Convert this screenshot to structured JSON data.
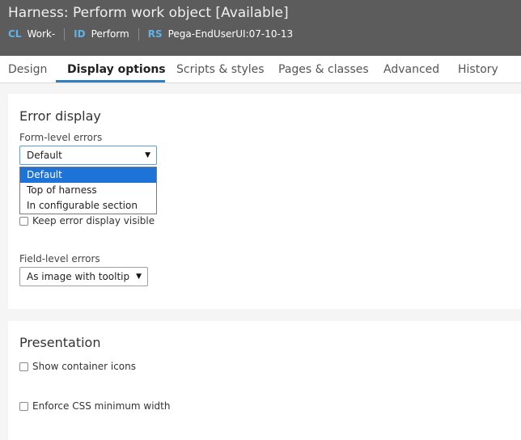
{
  "header": {
    "title": "Harness: Perform work object [Available]",
    "meta": [
      {
        "key": "CL",
        "value": "Work-"
      },
      {
        "key": "ID",
        "value": "Perform"
      },
      {
        "key": "RS",
        "value": "Pega-EndUserUI:07-10-13"
      }
    ]
  },
  "tabs": [
    "Design",
    "Display options",
    "Scripts & styles",
    "Pages & classes",
    "Advanced",
    "History"
  ],
  "active_tab": "Display options",
  "error_display": {
    "title": "Error display",
    "form_level_label": "Form-level errors",
    "form_level_value": "Default",
    "form_level_options": [
      "Default",
      "Top of harness",
      "In configurable section"
    ],
    "keep_visible_label": "Keep error display visible",
    "keep_visible_checked": false,
    "field_level_label": "Field-level errors",
    "field_level_value": "As image with tooltip"
  },
  "presentation": {
    "title": "Presentation",
    "show_icons_label": "Show container icons",
    "show_icons_checked": false,
    "enforce_css_label": "Enforce CSS minimum width",
    "enforce_css_checked": false
  },
  "colors": {
    "header_bg": "#5c5c5c",
    "meta_key": "#5fb3e8",
    "accent": "#2f7fc1",
    "selected_option": "#1e73d8"
  }
}
